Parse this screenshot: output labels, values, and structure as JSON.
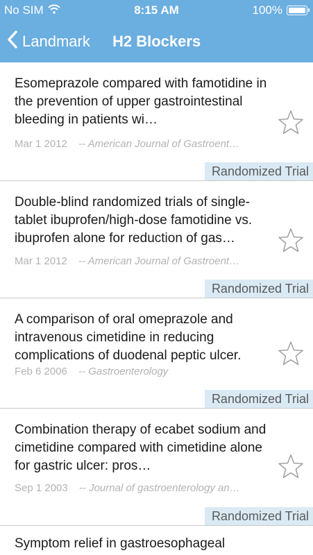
{
  "status_bar": {
    "carrier": "No SIM",
    "time": "8:15 AM",
    "battery": "100%"
  },
  "nav": {
    "back_label": "Landmark",
    "title": "H2 Blockers"
  },
  "articles": [
    {
      "title": "Esomeprazole compared with famotidine in the prevention of upper gastrointestinal bleeding in patients wi…",
      "date": "Mar 1 2012",
      "journal": "-- American Journal of Gastroent…",
      "tag": "Randomized Trial"
    },
    {
      "title": "Double-blind randomized trials of single-tablet ibuprofen/high-dose famotidine vs. ibuprofen alone for reduction of gas…",
      "date": "Mar 1 2012",
      "journal": "-- American Journal of Gastroent…",
      "tag": "Randomized Trial"
    },
    {
      "title": "A comparison of oral omeprazole and intravenous cimetidine in reducing complications of duodenal peptic ulcer.",
      "date": "Feb 6 2006",
      "journal": "-- Gastroenterology",
      "tag": "Randomized Trial"
    },
    {
      "title": "Combination therapy of ecabet sodium and cimetidine compared with cimetidine alone for gastric ulcer: pros…",
      "date": "Sep 1 2003",
      "journal": "-- Journal of gastroenterology an…",
      "tag": "Randomized Trial"
    },
    {
      "title": "Symptom relief in gastroesophageal",
      "date": "",
      "journal": "",
      "tag": ""
    }
  ],
  "colors": {
    "header": "#6baee0",
    "tag_background": "#daeaf5",
    "meta_text": "#b3b3b3",
    "star_outline": "#9a9a9a"
  }
}
